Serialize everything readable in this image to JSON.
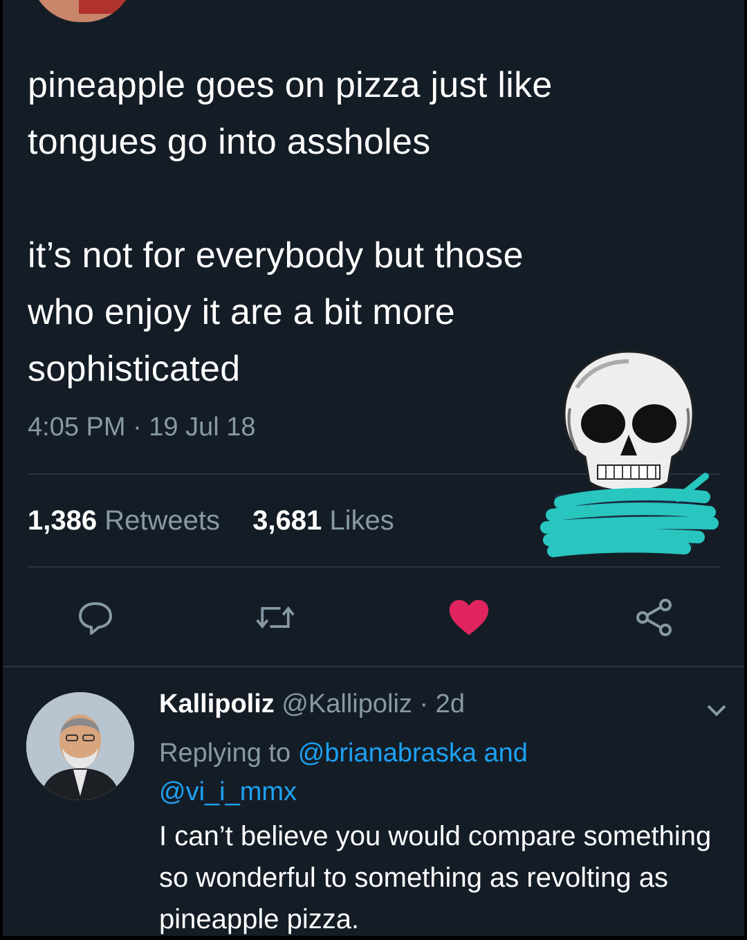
{
  "tweet": {
    "text": "pineapple goes on pizza just like\ntongues go into assholes\n\nit’s not for everybody but those\nwho enjoy it are a bit more\nsophisticated",
    "timestamp": "4:05 PM · 19 Jul 18",
    "retweets_count": "1,386",
    "retweets_label": "Retweets",
    "likes_count": "3,681",
    "likes_label": "Likes"
  },
  "actions": {
    "reply_icon": "reply-icon",
    "retweet_icon": "retweet-icon",
    "like_icon": "heart-icon",
    "share_icon": "share-icon",
    "like_color": "#e0245e"
  },
  "reply": {
    "name": "Kallipoliz",
    "handle": "@Kallipoliz",
    "time": "· 2d",
    "replying_prefix": "Replying to",
    "replying_mention1": "@brianabraska",
    "replying_and": "and",
    "replying_mention2": "@vi_i_mmx",
    "text": "I can’t believe you would compare something so wonderful to something as revolting as pineapple pizza."
  },
  "colors": {
    "background": "#141d26",
    "secondary_text": "#8899a6",
    "link": "#1da1f2",
    "scribble": "#29c6c0"
  }
}
